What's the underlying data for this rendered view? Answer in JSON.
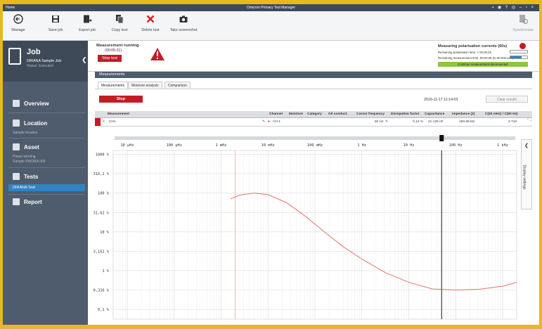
{
  "window": {
    "app_label": "Home",
    "title": "Omicron Primary Test Manager",
    "controls": "▪ ◉ ? ◎ – ▫ ×"
  },
  "ribbon": {
    "manage": "Manage",
    "save": "Save job",
    "export": "Export job",
    "copy": "Copy test",
    "delete": "Delete test",
    "screenshot": "Take screenshot",
    "synchronize": "Synchronize"
  },
  "sidebar": {
    "job_title": "Job",
    "job_name": "DIRANA Sample Job",
    "job_status": "Status: Executed",
    "overview": "Overview",
    "location": "Location",
    "location_sub": "Sample location",
    "asset": "Asset",
    "asset_sub1": "Power winding",
    "asset_sub2": "Sample PWDRA 000",
    "tests": "Tests",
    "test_selected": "DIRANA Test",
    "report": "Report"
  },
  "run": {
    "status": "Measurement running",
    "time": "(00:05:21)",
    "stop_test": "Stop test",
    "pol_title": "Measuring polarisation currents (60s)",
    "pol_remaining": "Remaining polarisation time: < 00:00:25",
    "pol_meas": "Remaining measurement time: 00:00:28 (to 60.000 uHz)",
    "continue": "Continue measurement disconnected"
  },
  "measurements": {
    "section": "Measurements",
    "tabs": [
      "Measurements",
      "Moisture analysis",
      "Comparison"
    ],
    "stop": "Stop",
    "datetime": "2016-11-17 11:14:03",
    "clear": "Clear results"
  },
  "table": {
    "headers": [
      "Measurement",
      "Channel",
      "Moisture",
      "Category",
      "Oil conduct.",
      "Cursor frequency",
      "Dissipation factor",
      "Capacitance",
      "Impedance (Z)",
      "C(30 mHz) / C(50 Hz)"
    ],
    "row": {
      "name": "CH1",
      "channel": "CH 1",
      "moisture": "",
      "category": "",
      "oil": "",
      "cursor_freq": "50 Hz",
      "dissipation": "0.12 %",
      "capacitance": "21.135 nF",
      "impedance": "150.68 kΩ",
      "ratio": "2.710"
    }
  },
  "chart_data": {
    "type": "line",
    "title": "",
    "xlabel": "",
    "ylabel": "",
    "x_scale": "log",
    "y_scale": "log",
    "x_ticks": [
      "10 μHz",
      "100 μHz",
      "1 mHz",
      "10 mHz",
      "100 mHz",
      "1 Hz",
      "10 Hz",
      "100 Hz",
      "1 kHz"
    ],
    "y_ticks": [
      "1000 %",
      "316,2 %",
      "100 %",
      "31,62 %",
      "10 %",
      "3,162 %",
      "1 %",
      "0,316 %",
      "0,1 %"
    ],
    "xlim_log10": [
      -5.3,
      3.3
    ],
    "ylim_log10": [
      -1.25,
      3.1
    ],
    "series": [
      {
        "color": "#e57366",
        "x_log10": [
          -2.8,
          -2.6,
          -2.3,
          -2.0,
          -1.6,
          -1.2,
          -0.8,
          -0.4,
          0.0,
          0.5,
          1.0,
          1.5,
          2.0,
          2.5,
          3.0,
          3.3
        ],
        "y_log10": [
          1.85,
          1.95,
          2.0,
          1.96,
          1.75,
          1.4,
          1.0,
          0.62,
          0.3,
          -0.05,
          -0.3,
          -0.47,
          -0.5,
          -0.48,
          -0.4,
          -0.3
        ]
      }
    ],
    "cursor_x_log10": 1.7,
    "marker_x_log10": -2.7
  },
  "side": {
    "display_settings": "Display settings"
  },
  "colors": {
    "accent_red": "#c41c24",
    "sidebar": "#4f5c6d",
    "selected": "#2f83c5"
  }
}
